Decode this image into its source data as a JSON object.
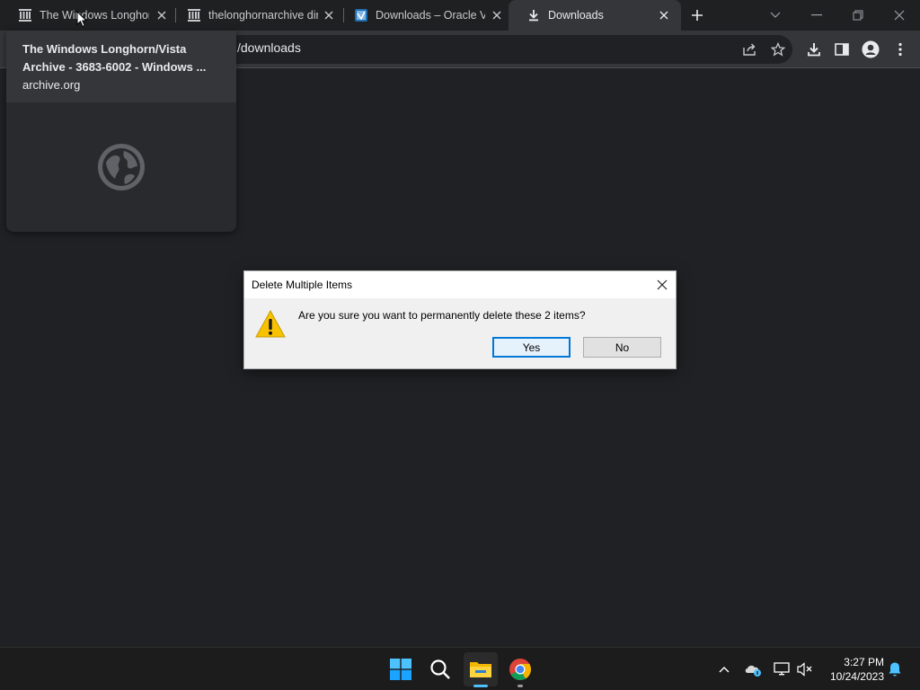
{
  "browser": {
    "tabs": [
      {
        "title": "The Windows Longhorn/Vista Archive",
        "favicon": "archive-icon",
        "active": false
      },
      {
        "title": "thelonghornarchive directory",
        "favicon": "archive-icon",
        "active": false
      },
      {
        "title": "Downloads – Oracle VM",
        "favicon": "virtualbox-icon",
        "active": false
      },
      {
        "title": "Downloads",
        "favicon": "download-icon",
        "active": true
      }
    ],
    "url": "/downloads"
  },
  "hover_card": {
    "title_line1": "The Windows Longhorn/Vista",
    "title_line2": "Archive - 3683-6002 - Windows ...",
    "domain": "archive.org"
  },
  "dialog": {
    "title": "Delete Multiple Items",
    "message": "Are you sure you want to permanently delete these 2 items?",
    "yes_label": "Yes",
    "no_label": "No"
  },
  "taskbar": {
    "time": "3:27 PM",
    "date": "10/24/2023"
  },
  "colors": {
    "accent": "#0078d7",
    "warning": "#f8c200",
    "browser_dark": "#202124"
  }
}
